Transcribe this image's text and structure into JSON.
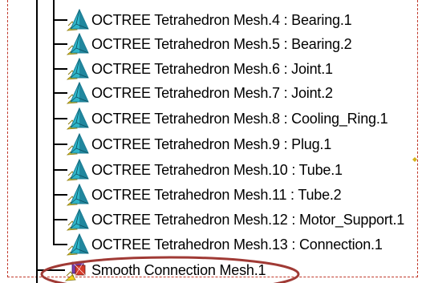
{
  "tree": {
    "items": [
      {
        "label": "OCTREE Tetrahedron Mesh.4 : Bearing.1",
        "icon": "octree-tetra-mesh-icon"
      },
      {
        "label": "OCTREE Tetrahedron Mesh.5 : Bearing.2",
        "icon": "octree-tetra-mesh-icon"
      },
      {
        "label": "OCTREE Tetrahedron Mesh.6 : Joint.1",
        "icon": "octree-tetra-mesh-icon"
      },
      {
        "label": "OCTREE Tetrahedron Mesh.7 : Joint.2",
        "icon": "octree-tetra-mesh-icon"
      },
      {
        "label": "OCTREE Tetrahedron Mesh.8 : Cooling_Ring.1",
        "icon": "octree-tetra-mesh-icon"
      },
      {
        "label": "OCTREE Tetrahedron Mesh.9 : Plug.1",
        "icon": "octree-tetra-mesh-icon"
      },
      {
        "label": "OCTREE Tetrahedron Mesh.10 : Tube.1",
        "icon": "octree-tetra-mesh-icon"
      },
      {
        "label": "OCTREE Tetrahedron Mesh.11 : Tube.2",
        "icon": "octree-tetra-mesh-icon"
      },
      {
        "label": "OCTREE Tetrahedron Mesh.12 : Motor_Support.1",
        "icon": "octree-tetra-mesh-icon"
      },
      {
        "label": "OCTREE Tetrahedron Mesh.13 : Connection.1",
        "icon": "octree-tetra-mesh-icon"
      },
      {
        "label": "Smooth Connection Mesh.1",
        "icon": "smooth-connection-mesh-icon",
        "highlighted": true
      }
    ]
  },
  "colors": {
    "annotation": "#a03a35",
    "dashed_border": "#c0392b",
    "tetra_cyan": "#2fb6c9",
    "tetra_dark": "#1f7f96",
    "mesh_yellow": "#f2d21b",
    "connection_purple": "#7a3fb0",
    "connection_red": "#d63a2a"
  }
}
